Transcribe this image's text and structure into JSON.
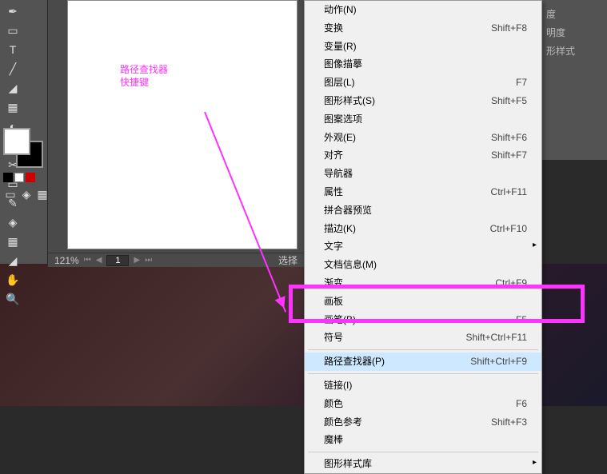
{
  "annotation": {
    "line1": "路径查找器",
    "line2": "快捷键"
  },
  "status": {
    "zoom": "121%",
    "page": "1"
  },
  "swatch_mini": {
    "c1": "#000",
    "c2": "#fff",
    "c3": "#f00"
  },
  "right_panel": {
    "i1": "度",
    "i2": "明度",
    "i3": "形样式"
  },
  "menu": {
    "items": [
      {
        "label": "动作(N)",
        "sc": "",
        "sub": false
      },
      {
        "label": "变换",
        "sc": "Shift+F8",
        "sub": false
      },
      {
        "label": "变量(R)",
        "sc": "",
        "sub": false
      },
      {
        "label": "图像描摹",
        "sc": "",
        "sub": false
      },
      {
        "label": "图层(L)",
        "sc": "F7",
        "sub": false
      },
      {
        "label": "图形样式(S)",
        "sc": "Shift+F5",
        "sub": false
      },
      {
        "label": "图案选项",
        "sc": "",
        "sub": false
      },
      {
        "label": "外观(E)",
        "sc": "Shift+F6",
        "sub": false
      },
      {
        "label": "对齐",
        "sc": "Shift+F7",
        "sub": false
      },
      {
        "label": "导航器",
        "sc": "",
        "sub": false
      },
      {
        "label": "属性",
        "sc": "Ctrl+F11",
        "sub": false
      },
      {
        "label": "拼合器预览",
        "sc": "",
        "sub": false
      },
      {
        "label": "描边(K)",
        "sc": "Ctrl+F10",
        "sub": false
      },
      {
        "label": "文字",
        "sc": "",
        "sub": true
      },
      {
        "label": "文档信息(M)",
        "sc": "",
        "sub": false
      },
      {
        "label": "渐变",
        "sc": "Ctrl+F9",
        "sub": false
      },
      {
        "label": "画板",
        "sc": "",
        "sub": false
      },
      {
        "label": "画笔(B)",
        "sc": "F5",
        "sub": false
      },
      {
        "label": "符号",
        "sc": "Shift+Ctrl+F11",
        "sub": false
      },
      {
        "hr": true
      },
      {
        "label": "路径查找器(P)",
        "sc": "Shift+Ctrl+F9",
        "sub": false,
        "sel": true
      },
      {
        "hr": true
      },
      {
        "label": "链接(I)",
        "sc": "",
        "sub": false
      },
      {
        "label": "颜色",
        "sc": "F6",
        "sub": false
      },
      {
        "label": "颜色参考",
        "sc": "Shift+F3",
        "sub": false
      },
      {
        "label": "魔棒",
        "sc": "",
        "sub": false
      },
      {
        "hr": true
      },
      {
        "label": "图形样式库",
        "sc": "",
        "sub": true
      }
    ]
  },
  "tools": [
    "✒",
    "▭",
    "T",
    "/",
    "◢",
    "▦",
    "◐",
    "▤",
    "✂",
    "▭",
    "✎",
    "◈",
    "▦",
    "◢",
    "✋",
    "🔍"
  ]
}
